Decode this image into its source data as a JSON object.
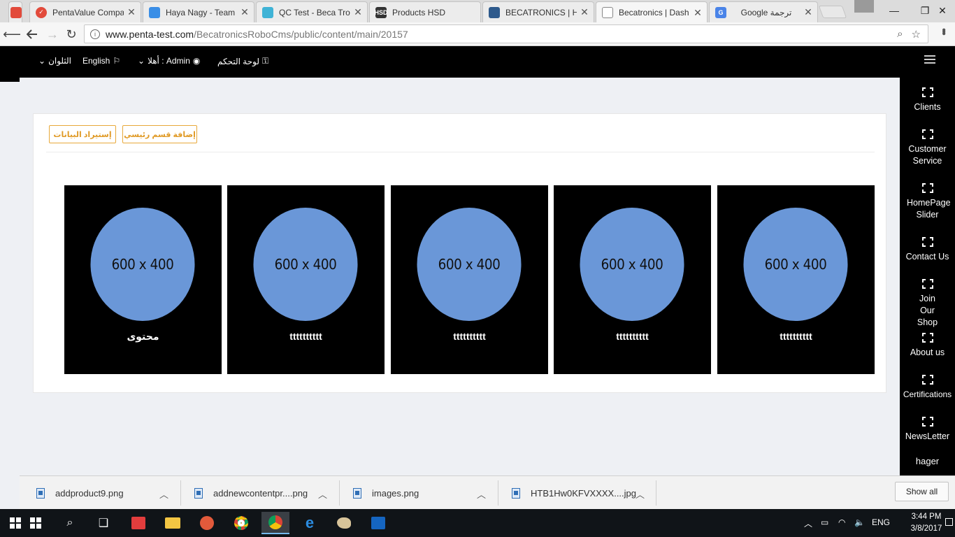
{
  "browser": {
    "tabs": [
      {
        "title": "PentaValue Compa",
        "color": "#e24a3b"
      },
      {
        "title": "Haya Nagy - Team",
        "color": "#3a8ee6"
      },
      {
        "title": "QC Test - Beca Tro",
        "color": "#3fb3d6"
      },
      {
        "title": "Products HSD",
        "color": "#333333"
      },
      {
        "title": "BECATRONICS | Ho",
        "color": "#2e5a8c"
      },
      {
        "title": "Becatronics | Dash",
        "color": "#ffffff"
      },
      {
        "title": "Google ترجمة",
        "color": "#4a84e8"
      }
    ],
    "url_host": "www.penta-test.com",
    "url_path": "/BecatronicsRoboCms/public/content/main/20157"
  },
  "topnav": {
    "themes": "الثلوان",
    "language": "English",
    "greeting": "أهلا : Admin",
    "dashboard": "لوحة التحكم"
  },
  "sidebar": {
    "items": [
      "Clients",
      "Customer Service",
      "HomePage Slider",
      "Contact Us",
      "Join Our Shop",
      "About us",
      "Certifications",
      "NewsLetter"
    ],
    "user": "hager"
  },
  "panel": {
    "import_button": "إستيراد البيانات",
    "add_button": "إضافة قسم رئيسي"
  },
  "cards": [
    {
      "image_text": "600 x 400",
      "label": "محتوى"
    },
    {
      "image_text": "600 x 400",
      "label": "tttttttttt"
    },
    {
      "image_text": "600 x 400",
      "label": "tttttttttt"
    },
    {
      "image_text": "600 x 400",
      "label": "tttttttttt"
    },
    {
      "image_text": "600 x 400",
      "label": "tttttttttt"
    }
  ],
  "downloads": {
    "items": [
      "addproduct9.png",
      "addnewcontentpr....png",
      "images.png",
      "HTB1Hw0KFVXXXX....jpg"
    ],
    "show_all": "Show all"
  },
  "taskbar": {
    "lang": "ENG",
    "time": "3:44 PM",
    "date": "3/8/2017"
  }
}
